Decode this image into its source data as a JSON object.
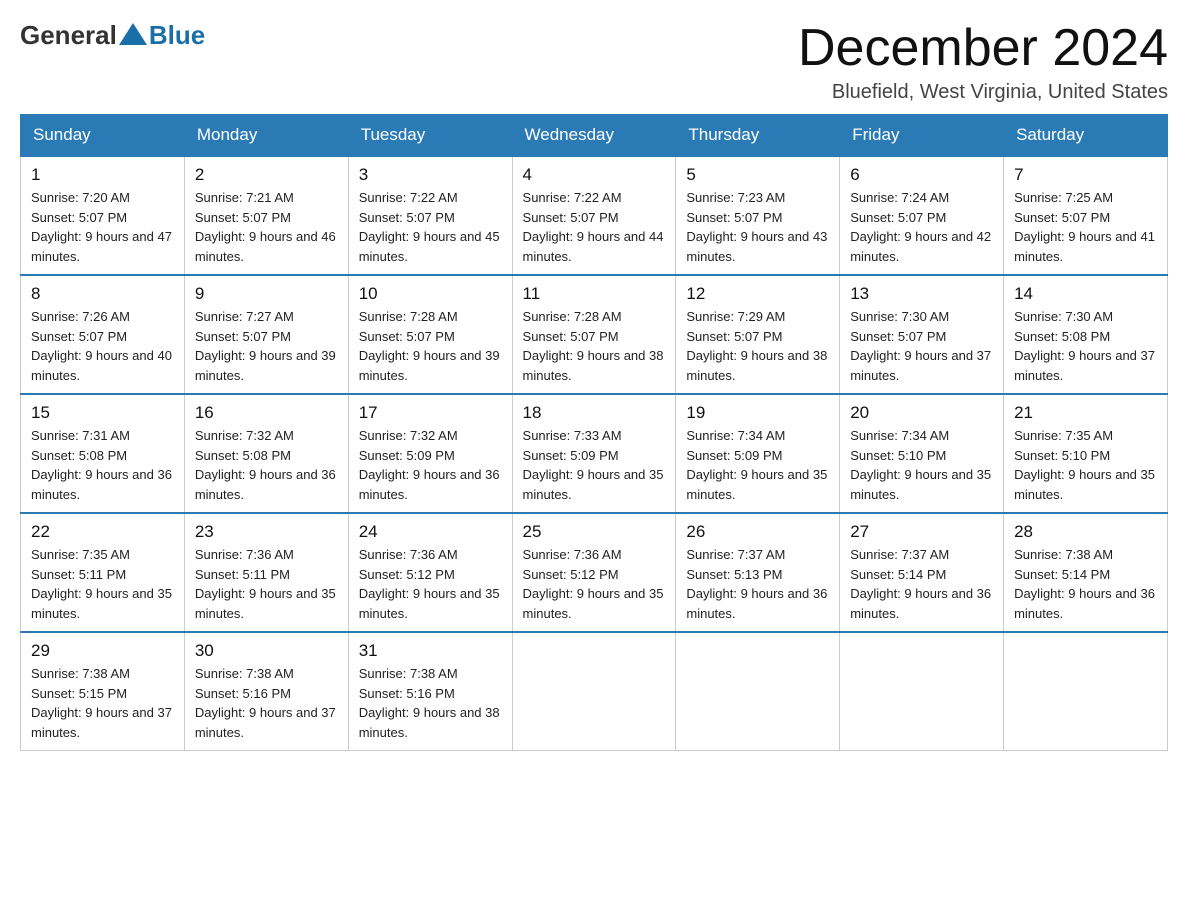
{
  "header": {
    "logo_general": "General",
    "logo_blue": "Blue",
    "month_title": "December 2024",
    "location": "Bluefield, West Virginia, United States"
  },
  "weekdays": [
    "Sunday",
    "Monday",
    "Tuesday",
    "Wednesday",
    "Thursday",
    "Friday",
    "Saturday"
  ],
  "weeks": [
    [
      {
        "day": "1",
        "sunrise": "7:20 AM",
        "sunset": "5:07 PM",
        "daylight": "9 hours and 47 minutes."
      },
      {
        "day": "2",
        "sunrise": "7:21 AM",
        "sunset": "5:07 PM",
        "daylight": "9 hours and 46 minutes."
      },
      {
        "day": "3",
        "sunrise": "7:22 AM",
        "sunset": "5:07 PM",
        "daylight": "9 hours and 45 minutes."
      },
      {
        "day": "4",
        "sunrise": "7:22 AM",
        "sunset": "5:07 PM",
        "daylight": "9 hours and 44 minutes."
      },
      {
        "day": "5",
        "sunrise": "7:23 AM",
        "sunset": "5:07 PM",
        "daylight": "9 hours and 43 minutes."
      },
      {
        "day": "6",
        "sunrise": "7:24 AM",
        "sunset": "5:07 PM",
        "daylight": "9 hours and 42 minutes."
      },
      {
        "day": "7",
        "sunrise": "7:25 AM",
        "sunset": "5:07 PM",
        "daylight": "9 hours and 41 minutes."
      }
    ],
    [
      {
        "day": "8",
        "sunrise": "7:26 AM",
        "sunset": "5:07 PM",
        "daylight": "9 hours and 40 minutes."
      },
      {
        "day": "9",
        "sunrise": "7:27 AM",
        "sunset": "5:07 PM",
        "daylight": "9 hours and 39 minutes."
      },
      {
        "day": "10",
        "sunrise": "7:28 AM",
        "sunset": "5:07 PM",
        "daylight": "9 hours and 39 minutes."
      },
      {
        "day": "11",
        "sunrise": "7:28 AM",
        "sunset": "5:07 PM",
        "daylight": "9 hours and 38 minutes."
      },
      {
        "day": "12",
        "sunrise": "7:29 AM",
        "sunset": "5:07 PM",
        "daylight": "9 hours and 38 minutes."
      },
      {
        "day": "13",
        "sunrise": "7:30 AM",
        "sunset": "5:07 PM",
        "daylight": "9 hours and 37 minutes."
      },
      {
        "day": "14",
        "sunrise": "7:30 AM",
        "sunset": "5:08 PM",
        "daylight": "9 hours and 37 minutes."
      }
    ],
    [
      {
        "day": "15",
        "sunrise": "7:31 AM",
        "sunset": "5:08 PM",
        "daylight": "9 hours and 36 minutes."
      },
      {
        "day": "16",
        "sunrise": "7:32 AM",
        "sunset": "5:08 PM",
        "daylight": "9 hours and 36 minutes."
      },
      {
        "day": "17",
        "sunrise": "7:32 AM",
        "sunset": "5:09 PM",
        "daylight": "9 hours and 36 minutes."
      },
      {
        "day": "18",
        "sunrise": "7:33 AM",
        "sunset": "5:09 PM",
        "daylight": "9 hours and 35 minutes."
      },
      {
        "day": "19",
        "sunrise": "7:34 AM",
        "sunset": "5:09 PM",
        "daylight": "9 hours and 35 minutes."
      },
      {
        "day": "20",
        "sunrise": "7:34 AM",
        "sunset": "5:10 PM",
        "daylight": "9 hours and 35 minutes."
      },
      {
        "day": "21",
        "sunrise": "7:35 AM",
        "sunset": "5:10 PM",
        "daylight": "9 hours and 35 minutes."
      }
    ],
    [
      {
        "day": "22",
        "sunrise": "7:35 AM",
        "sunset": "5:11 PM",
        "daylight": "9 hours and 35 minutes."
      },
      {
        "day": "23",
        "sunrise": "7:36 AM",
        "sunset": "5:11 PM",
        "daylight": "9 hours and 35 minutes."
      },
      {
        "day": "24",
        "sunrise": "7:36 AM",
        "sunset": "5:12 PM",
        "daylight": "9 hours and 35 minutes."
      },
      {
        "day": "25",
        "sunrise": "7:36 AM",
        "sunset": "5:12 PM",
        "daylight": "9 hours and 35 minutes."
      },
      {
        "day": "26",
        "sunrise": "7:37 AM",
        "sunset": "5:13 PM",
        "daylight": "9 hours and 36 minutes."
      },
      {
        "day": "27",
        "sunrise": "7:37 AM",
        "sunset": "5:14 PM",
        "daylight": "9 hours and 36 minutes."
      },
      {
        "day": "28",
        "sunrise": "7:38 AM",
        "sunset": "5:14 PM",
        "daylight": "9 hours and 36 minutes."
      }
    ],
    [
      {
        "day": "29",
        "sunrise": "7:38 AM",
        "sunset": "5:15 PM",
        "daylight": "9 hours and 37 minutes."
      },
      {
        "day": "30",
        "sunrise": "7:38 AM",
        "sunset": "5:16 PM",
        "daylight": "9 hours and 37 minutes."
      },
      {
        "day": "31",
        "sunrise": "7:38 AM",
        "sunset": "5:16 PM",
        "daylight": "9 hours and 38 minutes."
      },
      null,
      null,
      null,
      null
    ]
  ],
  "labels": {
    "sunrise_prefix": "Sunrise: ",
    "sunset_prefix": "Sunset: ",
    "daylight_prefix": "Daylight: "
  }
}
